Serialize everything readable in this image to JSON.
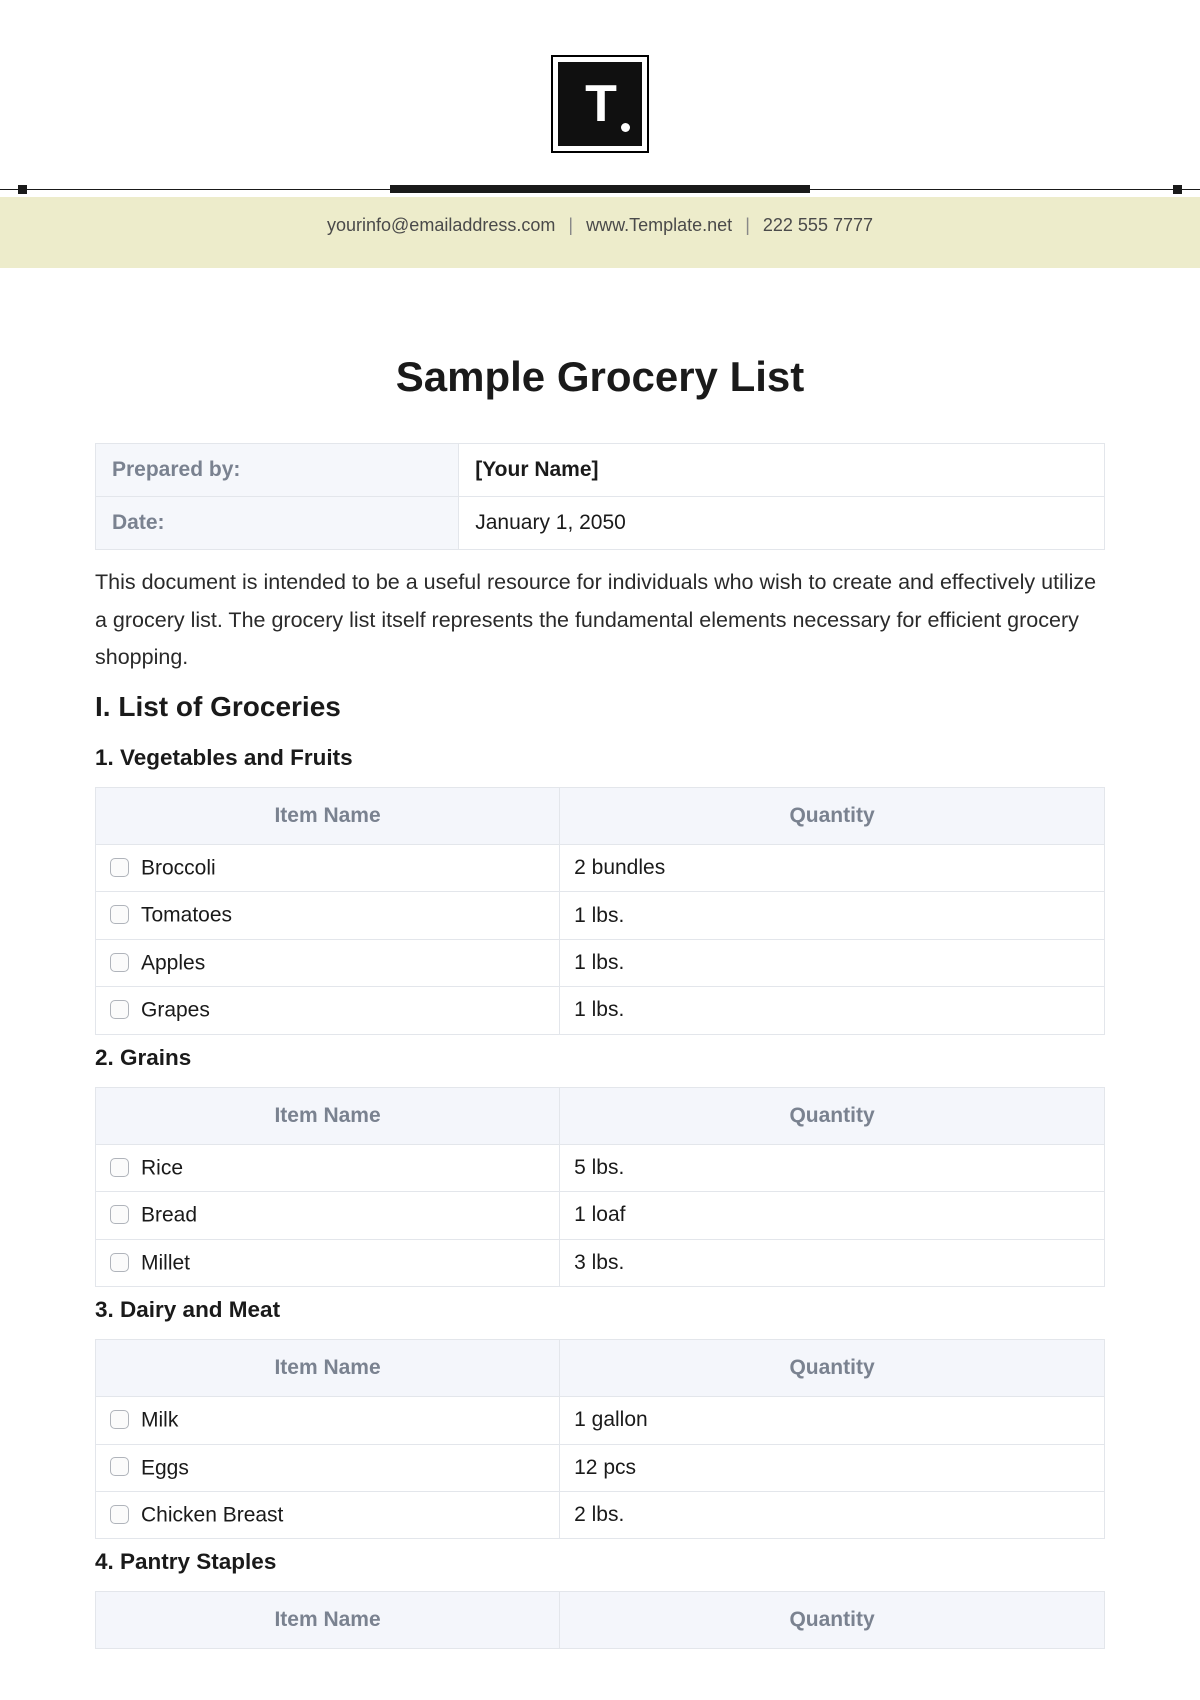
{
  "header": {
    "logo_letter": "T",
    "email": "yourinfo@emailaddress.com",
    "website": "www.Template.net",
    "phone": "222 555 7777"
  },
  "title": "Sample Grocery List",
  "meta": {
    "prepared_label": "Prepared by:",
    "prepared_value": "[Your Name]",
    "date_label": "Date:",
    "date_value": "January 1, 2050"
  },
  "intro": "This document is intended to be a useful resource for individuals who wish to create and effectively utilize a grocery list. The grocery list itself represents the fundamental elements necessary for efficient grocery shopping.",
  "section_heading": "I. List of Groceries",
  "columns": {
    "item": "Item Name",
    "qty": "Quantity"
  },
  "groups": [
    {
      "heading": "1. Vegetables and Fruits",
      "rows": [
        {
          "name": "Broccoli",
          "qty": "2 bundles"
        },
        {
          "name": "Tomatoes",
          "qty": "1 lbs."
        },
        {
          "name": "Apples",
          "qty": "1 lbs."
        },
        {
          "name": "Grapes",
          "qty": "1 lbs."
        }
      ]
    },
    {
      "heading": "2. Grains",
      "rows": [
        {
          "name": "Rice",
          "qty": "5 lbs."
        },
        {
          "name": "Bread",
          "qty": "1 loaf"
        },
        {
          "name": "Millet",
          "qty": "3 lbs."
        }
      ]
    },
    {
      "heading": "3. Dairy and Meat",
      "rows": [
        {
          "name": "Milk",
          "qty": "1 gallon"
        },
        {
          "name": "Eggs",
          "qty": "12 pcs"
        },
        {
          "name": "Chicken Breast",
          "qty": "2 lbs."
        }
      ]
    },
    {
      "heading": "4. Pantry Staples",
      "rows": []
    }
  ]
}
